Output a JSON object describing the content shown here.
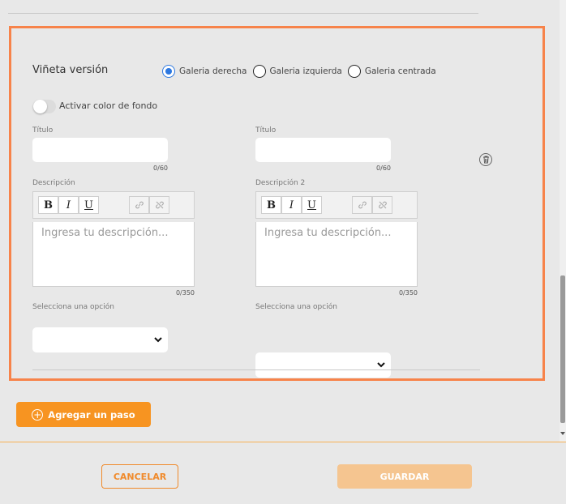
{
  "section": {
    "heading": "Viñeta versión",
    "radio_options": [
      {
        "label": "Galeria derecha",
        "checked": true
      },
      {
        "label": "Galeria izquierda",
        "checked": false
      },
      {
        "label": "Galeria centrada",
        "checked": false
      }
    ],
    "toggle_label": "Activar color de fondo",
    "columns": [
      {
        "title_label": "Título",
        "title_value": "",
        "title_counter": "0/60",
        "desc_label": "Descripción",
        "desc_placeholder": "Ingresa tu descripción...",
        "desc_counter": "0/350",
        "select_label": "Selecciona una opción",
        "select_value": ""
      },
      {
        "title_label": "Título",
        "title_value": "",
        "title_counter": "0/60",
        "desc_label": "Descripción 2",
        "desc_placeholder": "Ingresa tu descripción...",
        "desc_counter": "0/350",
        "select_label": "Selecciona una opción",
        "select_value": ""
      }
    ],
    "toolbar": {
      "bold": "B",
      "italic": "I",
      "underline": "U",
      "link_icon": "link-icon",
      "unlink_icon": "unlink-icon"
    },
    "delete_icon": "trash-icon"
  },
  "add_step_label": "Agregar un paso",
  "footer": {
    "cancel_label": "CANCELAR",
    "save_label": "GUARDAR"
  },
  "colors": {
    "accent": "#f79421",
    "panel_border": "#f7834a",
    "radio_checked": "#2d78e0",
    "save_disabled": "#f5c590"
  }
}
